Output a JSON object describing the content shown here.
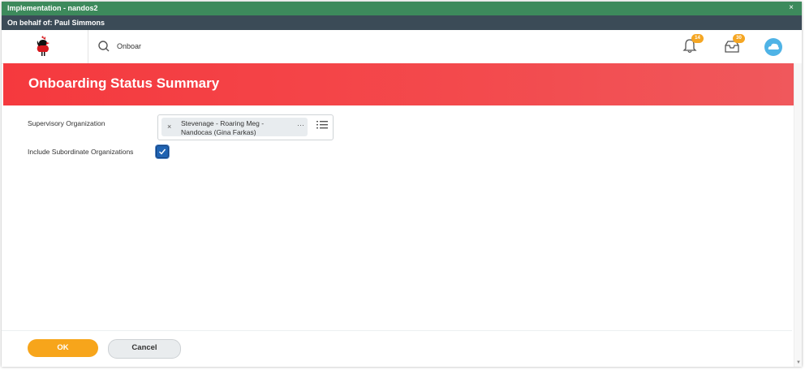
{
  "window": {
    "title": "Implementation - nandos2",
    "close_glyph": "×",
    "bar_color": "#3d8a5c"
  },
  "proxy": {
    "label": "On behalf of: Paul Simmons"
  },
  "header": {
    "logo_icon": "rooster-logo-icon",
    "search": {
      "icon": "search-icon",
      "value": "Onboar"
    },
    "notifications": {
      "icon": "bell-icon",
      "count": "14"
    },
    "inbox": {
      "icon": "inbox-icon",
      "count": "30"
    },
    "profile": {
      "icon": "cloud-avatar-icon"
    }
  },
  "banner": {
    "title": "Onboarding Status Summary",
    "color": "#f5393e"
  },
  "form": {
    "supervisory_org": {
      "label": "Supervisory Organization",
      "selected_line1": "Stevenage - Roaring Meg -",
      "selected_line2": "Nandocas (Gina Farkas)",
      "remove_glyph": "×",
      "more_glyph": "···"
    },
    "include_subordinate": {
      "label": "Include Subordinate Organizations",
      "checked": true
    }
  },
  "footer": {
    "ok_label": "OK",
    "cancel_label": "Cancel",
    "ok_color": "#f7a51b"
  }
}
